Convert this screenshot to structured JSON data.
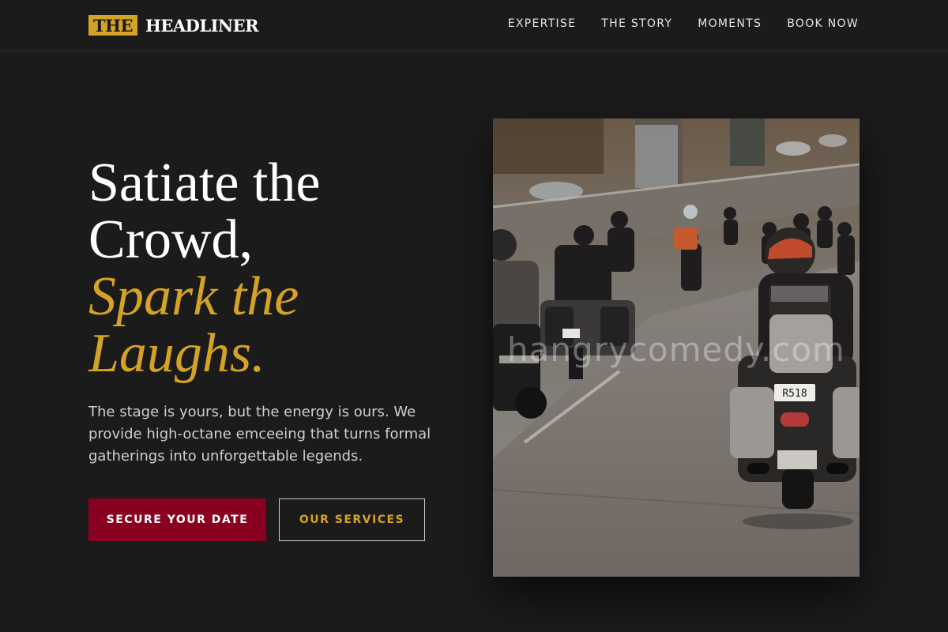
{
  "brand": {
    "badge": "THE",
    "name": "HEADLINER"
  },
  "nav": {
    "items": [
      {
        "label": "EXPERTISE"
      },
      {
        "label": "THE STORY"
      },
      {
        "label": "MOMENTS"
      },
      {
        "label": "BOOK NOW"
      }
    ]
  },
  "hero": {
    "line1": "Satiate the",
    "line2": "Crowd,",
    "accent1": "Spark the",
    "accent2": "Laughs.",
    "description": "The stage is yours, but the energy is ours. We provide high-octane emceeing that turns formal gatherings into unforgettable legends.",
    "primary_cta": "SECURE YOUR DATE",
    "secondary_cta": "OUR SERVICES"
  },
  "image": {
    "watermark": "hangrycomedy.com",
    "plate": "R518"
  },
  "colors": {
    "background": "#1b1b1b",
    "accent_gold": "#d4a325",
    "primary_red": "#8a0020",
    "text_white": "#ffffff"
  }
}
